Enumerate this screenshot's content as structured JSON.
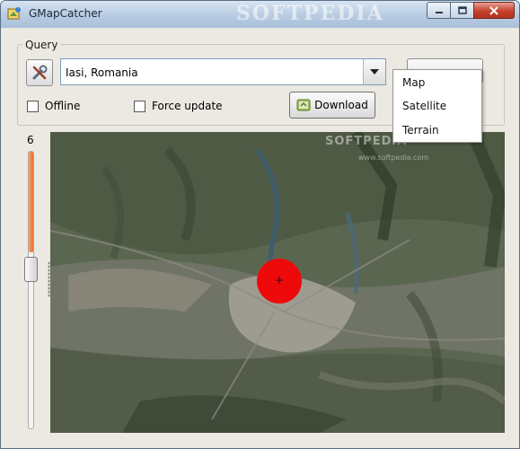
{
  "window": {
    "title": "GMapCatcher",
    "watermark": "SOFTPEDIA"
  },
  "query": {
    "frame_label": "Query",
    "location_value": "Iasi, Romania",
    "offline_label": "Offline",
    "offline_checked": false,
    "force_update_label": "Force update",
    "force_update_checked": false,
    "download_label": "Download"
  },
  "view_menu": {
    "items": [
      "Map",
      "Satellite",
      "Terrain"
    ]
  },
  "zoom": {
    "level_label": "6",
    "level": 6
  },
  "map": {
    "watermark_top": "SOFTPEDIA",
    "watermark_url": "www.softpedia.com",
    "marker_color": "#ee0a0a"
  },
  "colors": {
    "slider_fill": "#e86e26",
    "title_bar": "#b9cde3",
    "close_button": "#c5412d"
  }
}
